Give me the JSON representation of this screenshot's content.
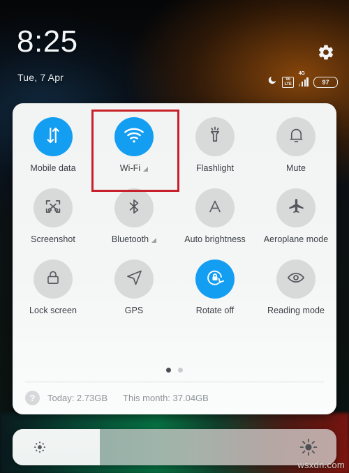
{
  "statusbar": {
    "time": "8:25",
    "date": "Tue, 7 Apr",
    "settings_icon": "gear-icon",
    "dnd_icon": "moon-icon",
    "volte_label_top": "Vo",
    "volte_label_bottom": "LTE",
    "network_type": "4G",
    "battery_percent": "97"
  },
  "quick_settings": {
    "tiles": [
      {
        "label": "Mobile data",
        "icon": "mobile-data-icon",
        "active": true,
        "expandable": false
      },
      {
        "label": "Wi-Fi",
        "icon": "wifi-icon",
        "active": true,
        "expandable": true
      },
      {
        "label": "Flashlight",
        "icon": "flashlight-icon",
        "active": false,
        "expandable": false
      },
      {
        "label": "Mute",
        "icon": "bell-icon",
        "active": false,
        "expandable": false
      },
      {
        "label": "Screenshot",
        "icon": "screenshot-icon",
        "active": false,
        "expandable": false
      },
      {
        "label": "Bluetooth",
        "icon": "bluetooth-icon",
        "active": false,
        "expandable": true
      },
      {
        "label": "Auto brightness",
        "icon": "auto-brightness-icon",
        "active": false,
        "expandable": false
      },
      {
        "label": "Aeroplane mode",
        "icon": "aeroplane-icon",
        "active": false,
        "expandable": false
      },
      {
        "label": "Lock screen",
        "icon": "lock-icon",
        "active": false,
        "expandable": false
      },
      {
        "label": "GPS",
        "icon": "gps-arrow-icon",
        "active": false,
        "expandable": false
      },
      {
        "label": "Rotate off",
        "icon": "rotate-lock-icon",
        "active": true,
        "expandable": false
      },
      {
        "label": "Reading mode",
        "icon": "eye-icon",
        "active": false,
        "expandable": false
      }
    ],
    "pages": {
      "count": 2,
      "active_index": 0
    },
    "data_usage": {
      "help_icon": "question-mark-icon",
      "today": "Today: 2.73GB",
      "month": "This month: 37.04GB"
    }
  },
  "brightness_slider": {
    "low_icon": "sun-small-icon",
    "high_icon": "sun-large-icon",
    "fill_percent": 27
  },
  "annotation": {
    "target": "Wi-Fi",
    "color": "#c8202a"
  },
  "watermark": {
    "text": "wsxdn.com"
  },
  "colors": {
    "tile_active": "#149ef2",
    "tile_inactive": "#d8dada",
    "panel_bg": "#f4f6f6",
    "label": "#3a3f44"
  }
}
